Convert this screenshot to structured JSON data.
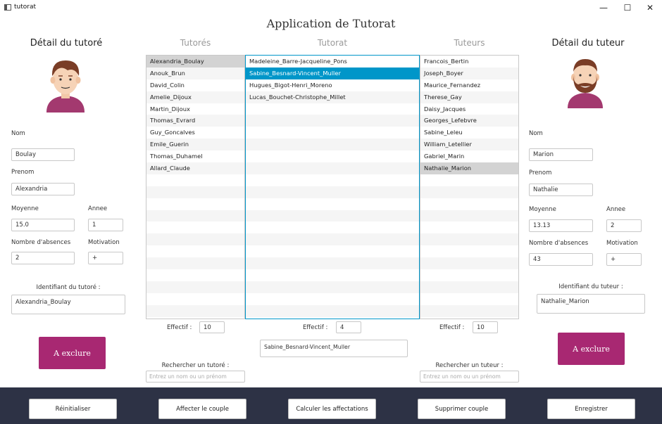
{
  "window": {
    "title": "tutorat",
    "minimize": "—",
    "maximize": "☐",
    "close": "✕"
  },
  "app_title": "Application de Tutorat",
  "columns": {
    "tutores": "Tutorés",
    "tutorat": "Tutorat",
    "tuteurs": "Tuteurs"
  },
  "left_detail": {
    "header": "Détail du tutoré",
    "nom_label": "Nom",
    "nom_value": "Boulay",
    "prenom_label": "Prenom",
    "prenom_value": "Alexandria",
    "moyenne_label": "Moyenne",
    "moyenne_value": "15.0",
    "annee_label": "Annee",
    "annee_value": "1",
    "absences_label": "Nombre d'absences",
    "absences_value": "2",
    "motivation_label": "Motivation",
    "motivation_value": "+",
    "id_label": "Identifiant du tutoré :",
    "id_value": "Alexandria_Boulay",
    "exclude_button": "A exclure"
  },
  "right_detail": {
    "header": "Détail du tuteur",
    "nom_label": "Nom",
    "nom_value": "Marion",
    "prenom_label": "Prenom",
    "prenom_value": "Nathalie",
    "moyenne_label": "Moyenne",
    "moyenne_value": "13.13",
    "annee_label": "Annee",
    "annee_value": "2",
    "absences_label": "Nombre d'absences",
    "absences_value": "43",
    "motivation_label": "Motivation",
    "motivation_value": "+",
    "id_label": "Identifiant du tuteur :",
    "id_value": "Nathalie_Marion",
    "exclude_button": "A exclure"
  },
  "tutores_list": {
    "items": [
      "Alexandria_Boulay",
      "Anouk_Brun",
      "David_Colin",
      "Amelie_Dijoux",
      "Martin_Dijoux",
      "Thomas_Evrard",
      "Guy_Goncalves",
      "Emile_Guerin",
      "Thomas_Duhamel",
      "Allard_Claude"
    ],
    "selected_index": 0,
    "effectif_label": "Effectif :",
    "effectif_value": "10",
    "search_label": "Rechercher un tutoré :",
    "search_placeholder": "Entrez un nom ou un prénom"
  },
  "tutorat_list": {
    "items": [
      "Madeleine_Barre-Jacqueline_Pons",
      "Sabine_Besnard-Vincent_Muller",
      "Hugues_Bigot-Henri_Moreno",
      "Lucas_Bouchet-Christophe_Millet"
    ],
    "selected_index": 1,
    "effectif_label": "Effectif :",
    "effectif_value": "4",
    "selected_display": "Sabine_Besnard-Vincent_Muller"
  },
  "tuteurs_list": {
    "items": [
      "Francois_Bertin",
      "Joseph_Boyer",
      "Maurice_Fernandez",
      "Therese_Gay",
      "Daisy_Jacques",
      "Georges_Lefebvre",
      "Sabine_Leleu",
      "William_Letellier",
      "Gabriel_Marin",
      "Nathalie_Marion"
    ],
    "selected_index": 9,
    "effectif_label": "Effectif :",
    "effectif_value": "10",
    "search_label": "Rechercher un tuteur :",
    "search_placeholder": "Entrez un nom ou un prénom"
  },
  "bottom_buttons": {
    "reset": "Réinitialiser",
    "assign": "Affecter le couple",
    "compute": "Calculer les affectations",
    "delete": "Supprimer couple",
    "save": "Enregistrer"
  },
  "colors": {
    "accent": "#a82872",
    "selection": "#0096c9",
    "bottom_bar": "#2d3245"
  }
}
